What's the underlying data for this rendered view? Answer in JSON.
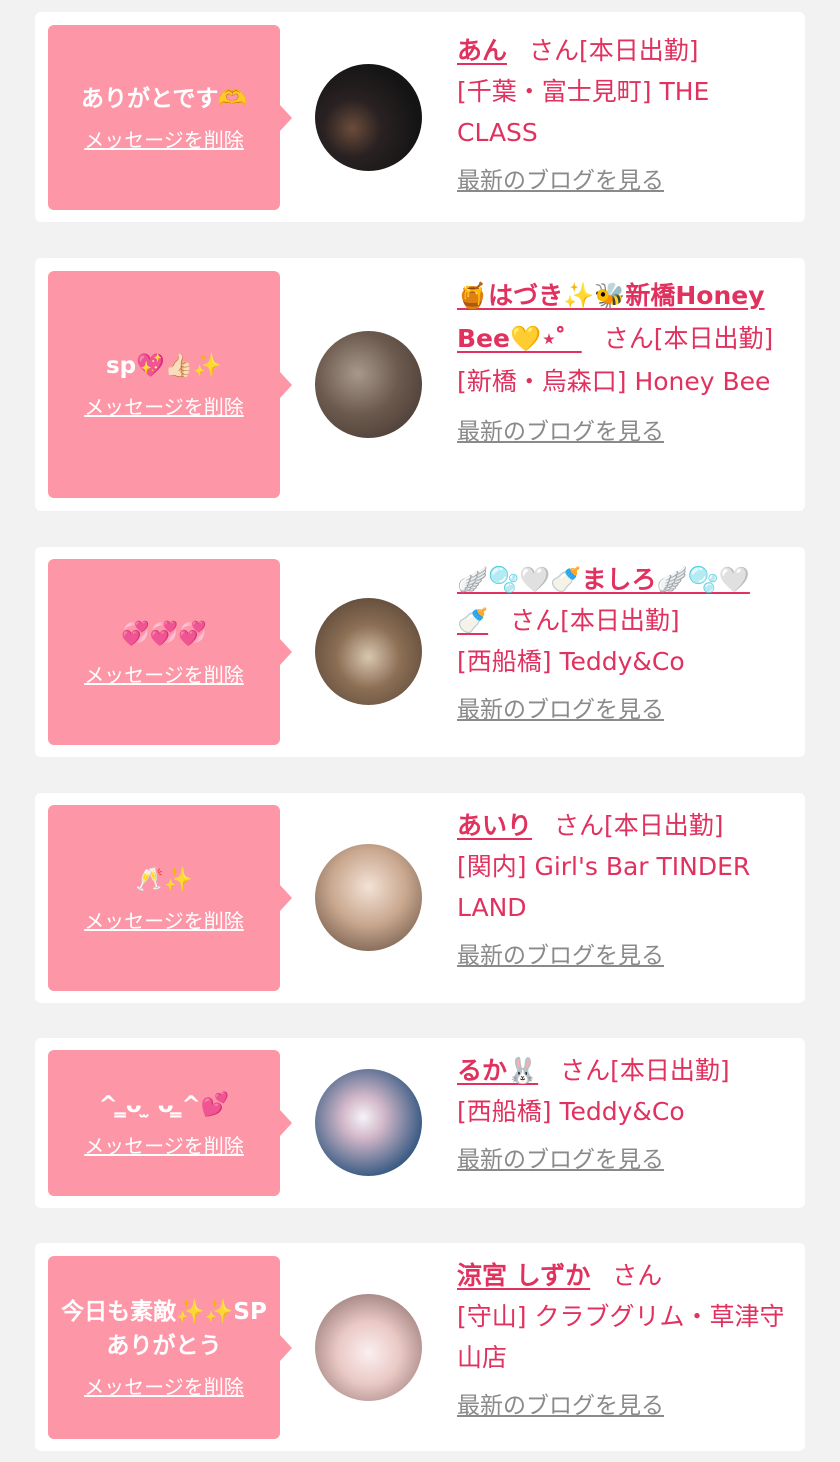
{
  "cards": [
    {
      "message": "ありがとです🫶",
      "delete_label": "メッセージを削除",
      "name": "あん",
      "suffix": "さん[本日出勤]",
      "shop": "[千葉・富士見町] THE CLASS",
      "blog_label": "最新のブログを見る"
    },
    {
      "message": "sp💖👍🏻✨",
      "delete_label": "メッセージを削除",
      "name": "🍯はづき✨🐝新橋Honey Bee💛⋆゜",
      "suffix": "さん[本日出勤]",
      "shop": "[新橋・烏森口] Honey Bee",
      "blog_label": "最新のブログを見る"
    },
    {
      "message": "💞💞💞",
      "delete_label": "メッセージを削除",
      "name": "🪽🫧🤍🍼ましろ🪽🫧🤍🍼",
      "suffix": "さん[本日出勤]",
      "shop": "[西船橋] Teddy&Co",
      "blog_label": "最新のブログを見る"
    },
    {
      "message": "🥂✨",
      "delete_label": "メッセージを削除",
      "name": "あいり",
      "suffix": "さん[本日出勤]",
      "shop": "[関内] Girl's Bar TINDER LAND",
      "blog_label": "最新のブログを見る"
    },
    {
      "message": "^ ̳ᴗ ̫ ᴗ ̳^💕",
      "delete_label": "メッセージを削除",
      "name": "るか🐰",
      "suffix": "さん[本日出勤]",
      "shop": "[西船橋] Teddy&Co",
      "blog_label": "最新のブログを見る"
    },
    {
      "message": "今日も素敵✨✨SPありがとう",
      "delete_label": "メッセージを削除",
      "name": "涼宮 しずか",
      "suffix": "さん",
      "shop": "[守山] クラブグリム・草津守山店",
      "blog_label": "最新のブログを見る"
    }
  ]
}
